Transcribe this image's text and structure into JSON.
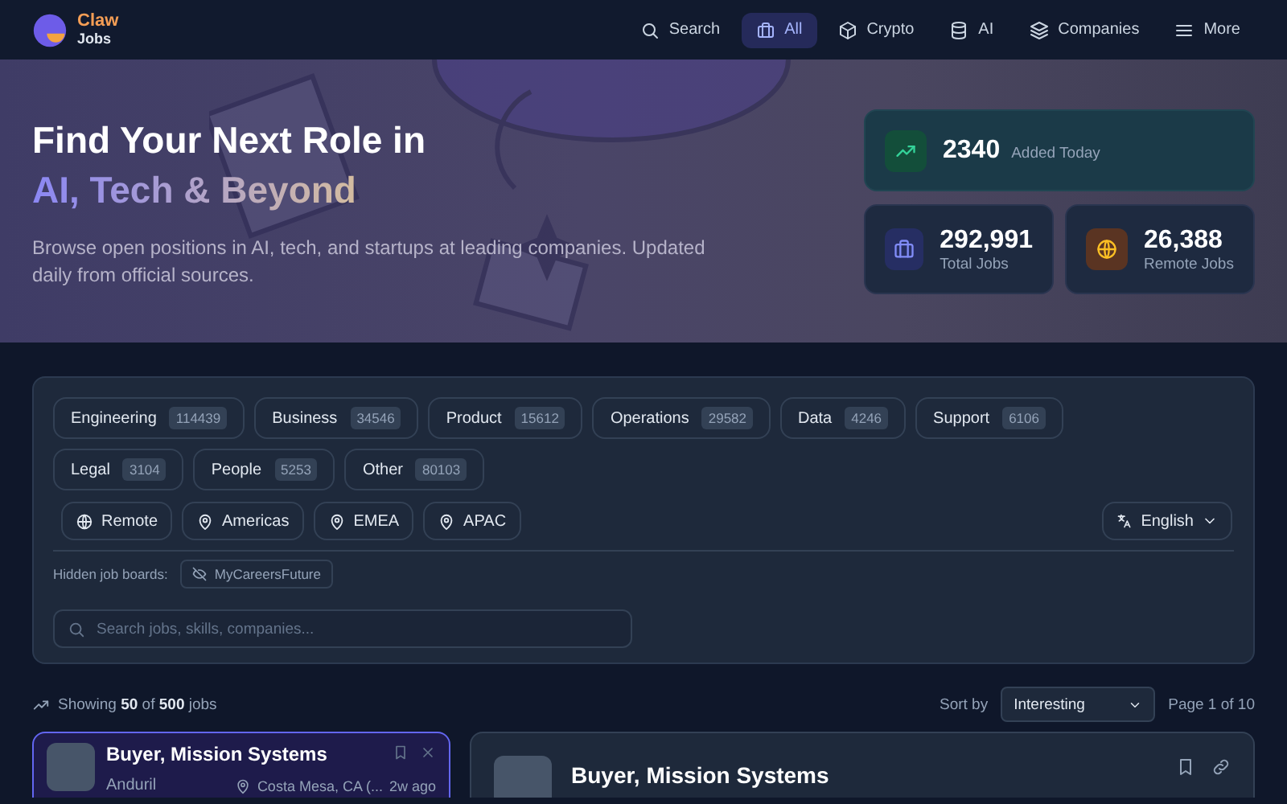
{
  "brand": {
    "name": "Claw",
    "sub": "Jobs"
  },
  "nav": [
    {
      "label": "Search",
      "kind": "search",
      "selected": false
    },
    {
      "label": "All",
      "kind": "briefcase",
      "selected": true
    },
    {
      "label": "Crypto",
      "kind": "cube",
      "selected": false
    },
    {
      "label": "AI",
      "kind": "database",
      "selected": false
    },
    {
      "label": "Companies",
      "kind": "layers",
      "selected": false
    },
    {
      "label": "More",
      "kind": "menu",
      "selected": false
    }
  ],
  "hero": {
    "title": "Find Your Next Role in",
    "highlight": "AI, Tech & Beyond",
    "description": "Browse open positions in AI, tech, and startups at leading companies. Updated daily from official sources."
  },
  "stats": [
    {
      "kind": "trend",
      "value": "2340",
      "label": "Added Today"
    },
    {
      "kind": "briefcase",
      "value": "292,991",
      "label": "Total Jobs"
    },
    {
      "kind": "globe",
      "value": "26,388",
      "label": "Remote Jobs"
    }
  ],
  "categories": [
    {
      "label": "Engineering",
      "count": "114439"
    },
    {
      "label": "Business",
      "count": "34546"
    },
    {
      "label": "Product",
      "count": "15612"
    },
    {
      "label": "Operations",
      "count": "29582"
    },
    {
      "label": "Data",
      "count": "4246"
    },
    {
      "label": "Support",
      "count": "6106"
    },
    {
      "label": "Legal",
      "count": "3104"
    },
    {
      "label": "People",
      "count": "5253"
    },
    {
      "label": "Other",
      "count": "80103"
    }
  ],
  "regions": [
    {
      "label": "Remote",
      "kind": "globe"
    },
    {
      "label": "Americas",
      "kind": "pin"
    },
    {
      "label": "EMEA",
      "kind": "pin"
    },
    {
      "label": "APAC",
      "kind": "pin"
    }
  ],
  "language": "English",
  "hidden_boards": {
    "label": "Hidden job boards:",
    "boards": [
      "MyCareersFuture"
    ]
  },
  "search": {
    "placeholder": "Search jobs, skills, companies..."
  },
  "results": {
    "summary": "Showing **50** of **500** jobs",
    "sort_label": "Sort by",
    "sort_value": "Interesting",
    "page": "Page 1 of 10"
  },
  "jobs": [
    {
      "title": "Buyer, Mission Systems",
      "company": "Anduril",
      "location": "Costa Mesa, CA (...",
      "age": "2w ago",
      "selected": true
    }
  ],
  "detail": {
    "title": "Buyer, Mission Systems"
  }
}
